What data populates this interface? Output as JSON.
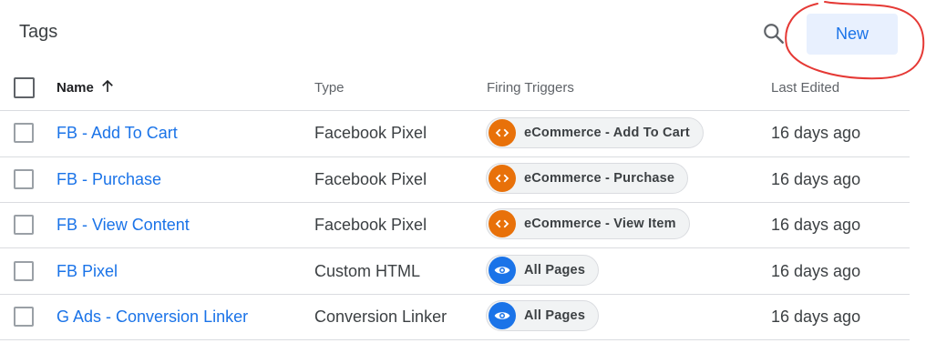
{
  "header": {
    "title": "Tags",
    "new_label": "New",
    "icons": {
      "search": "search-icon",
      "sort": "arrow-upward-icon"
    }
  },
  "columns": {
    "name": "Name",
    "type": "Type",
    "triggers": "Firing Triggers",
    "edited": "Last Edited"
  },
  "colors": {
    "accent": "#1a73e8",
    "button_bg": "#e8f0fe",
    "trigger_custom_event": "#e8710a",
    "trigger_page_view": "#1a73e8",
    "annotation": "#e53935"
  },
  "rows": [
    {
      "name": "FB - Add To Cart",
      "type": "Facebook Pixel",
      "trigger": "eCommerce - Add To Cart",
      "trigger_icon": "code-icon",
      "edited": "16 days ago"
    },
    {
      "name": "FB - Purchase",
      "type": "Facebook Pixel",
      "trigger": "eCommerce - Purchase",
      "trigger_icon": "code-icon",
      "edited": "16 days ago"
    },
    {
      "name": "FB - View Content",
      "type": "Facebook Pixel",
      "trigger": "eCommerce - View Item",
      "trigger_icon": "code-icon",
      "edited": "16 days ago"
    },
    {
      "name": "FB Pixel",
      "type": "Custom HTML",
      "trigger": "All Pages",
      "trigger_icon": "eye-icon",
      "edited": "16 days ago"
    },
    {
      "name": "G Ads - Conversion Linker",
      "type": "Conversion Linker",
      "trigger": "All Pages",
      "trigger_icon": "eye-icon",
      "edited": "16 days ago"
    }
  ]
}
